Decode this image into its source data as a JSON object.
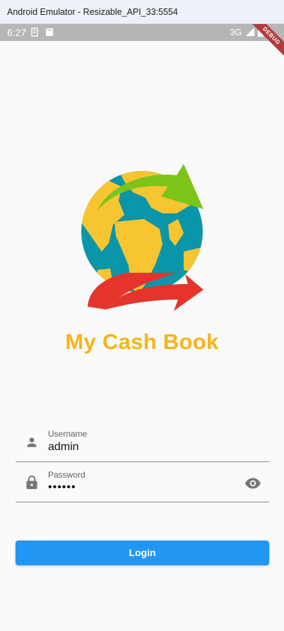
{
  "window": {
    "title": "Android Emulator - Resizable_API_33:5554"
  },
  "status_bar": {
    "time": "6:27",
    "network": "3G",
    "debug_label": "DEBUG"
  },
  "logo": {
    "brand": "My Cash Book",
    "brand_color": "#f7b41a"
  },
  "form": {
    "username": {
      "label": "Username",
      "value": "admin",
      "icon": "person-icon"
    },
    "password": {
      "label": "Password",
      "value": "••••••",
      "icon": "lock-icon",
      "toggle_icon": "eye-icon"
    },
    "login_label": "Login"
  },
  "colors": {
    "primary": "#2196f3",
    "arrow_green": "#7cc41a",
    "arrow_red": "#e5342c",
    "ocean": "#0b95a8",
    "land": "#f6c531"
  }
}
